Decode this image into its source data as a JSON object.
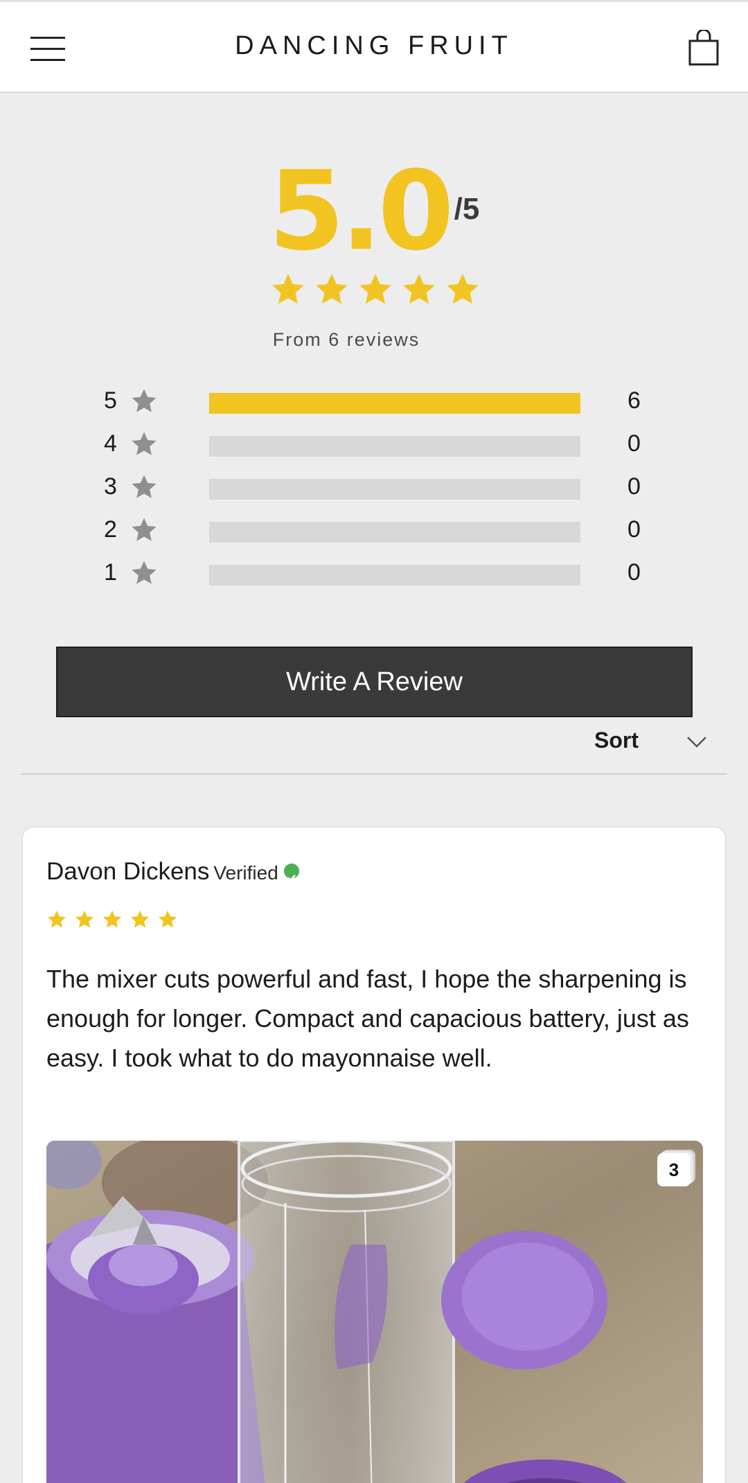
{
  "header": {
    "brand": "DANCING FRUIT",
    "menu_icon": "hamburger-menu-icon",
    "cart_icon": "shopping-bag-icon"
  },
  "summary": {
    "average": "5.0",
    "out_of": "/5",
    "stars": 5,
    "from_text": "From 6 reviews",
    "accent_color": "#f1c421",
    "distribution": [
      {
        "stars": "5",
        "count": "6",
        "fraction": 1.0
      },
      {
        "stars": "4",
        "count": "0",
        "fraction": 0
      },
      {
        "stars": "3",
        "count": "0",
        "fraction": 0
      },
      {
        "stars": "2",
        "count": "0",
        "fraction": 0
      },
      {
        "stars": "1",
        "count": "0",
        "fraction": 0
      }
    ]
  },
  "actions": {
    "write_review": "Write A Review",
    "sort_label": "Sort"
  },
  "reviews": [
    {
      "author": "Davon Dickens",
      "badge": "Verified",
      "rating": 5,
      "text": "The mixer cuts powerful and fast, I hope the sharpening is enough for longer. Compact and capacious battery, just as easy. I took what to do mayonnaise well.",
      "photo_count": "3"
    }
  ]
}
